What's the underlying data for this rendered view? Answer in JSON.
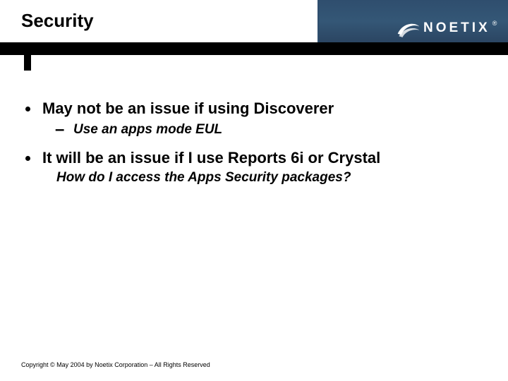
{
  "brand": {
    "name": "NOETIX",
    "reg": "®"
  },
  "title": "Security",
  "bullets": [
    {
      "text": "May not be an issue if using Discoverer",
      "sub": [
        {
          "text": "Use an apps mode EUL"
        }
      ]
    },
    {
      "text": "It will be an issue if I use Reports 6i or Crystal",
      "follow": "How do I access the Apps Security packages?"
    }
  ],
  "footer": "Copyright © May 2004 by Noetix Corporation – All Rights Reserved"
}
